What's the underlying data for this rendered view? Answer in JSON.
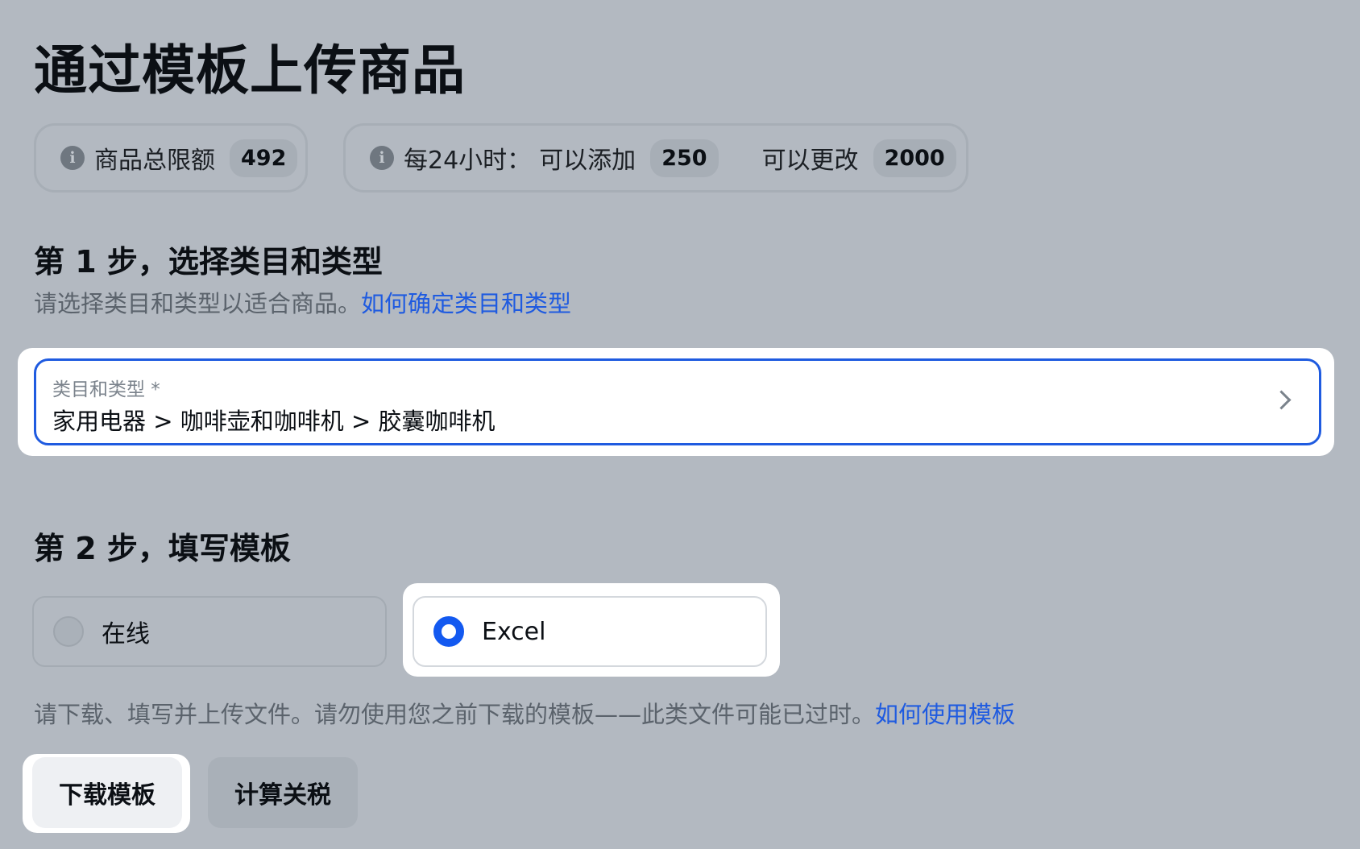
{
  "page": {
    "title": "通过模板上传商品"
  },
  "quota": {
    "total_label": "商品总限额",
    "total_value": "492",
    "per24_label": "每24小时：",
    "add_label": "可以添加",
    "add_value": "250",
    "edit_label": "可以更改",
    "edit_value": "2000"
  },
  "step1": {
    "title": "第 1 步，选择类目和类型",
    "hint": "请选择类目和类型以适合商品。",
    "link": "如何确定类目和类型",
    "field_label": "类目和类型 *",
    "field_value": "家用电器 > 咖啡壶和咖啡机 > 胶囊咖啡机"
  },
  "step2": {
    "title": "第 2 步，填写模板",
    "option_online": "在线",
    "option_excel": "Excel",
    "selected_option": "Excel",
    "hint": "请下载、填写并上传文件。请勿使用您之前下载的模板——此类文件可能已过时。",
    "link": "如何使用模板",
    "download_button": "下载模板",
    "tariff_button": "计算关税"
  },
  "colors": {
    "accent": "#1f5be0",
    "radio_selected": "#1359f0",
    "overlay": "#b3b9c1"
  },
  "icons": {
    "info": "info-icon",
    "chevron": "chevron-right-icon"
  }
}
